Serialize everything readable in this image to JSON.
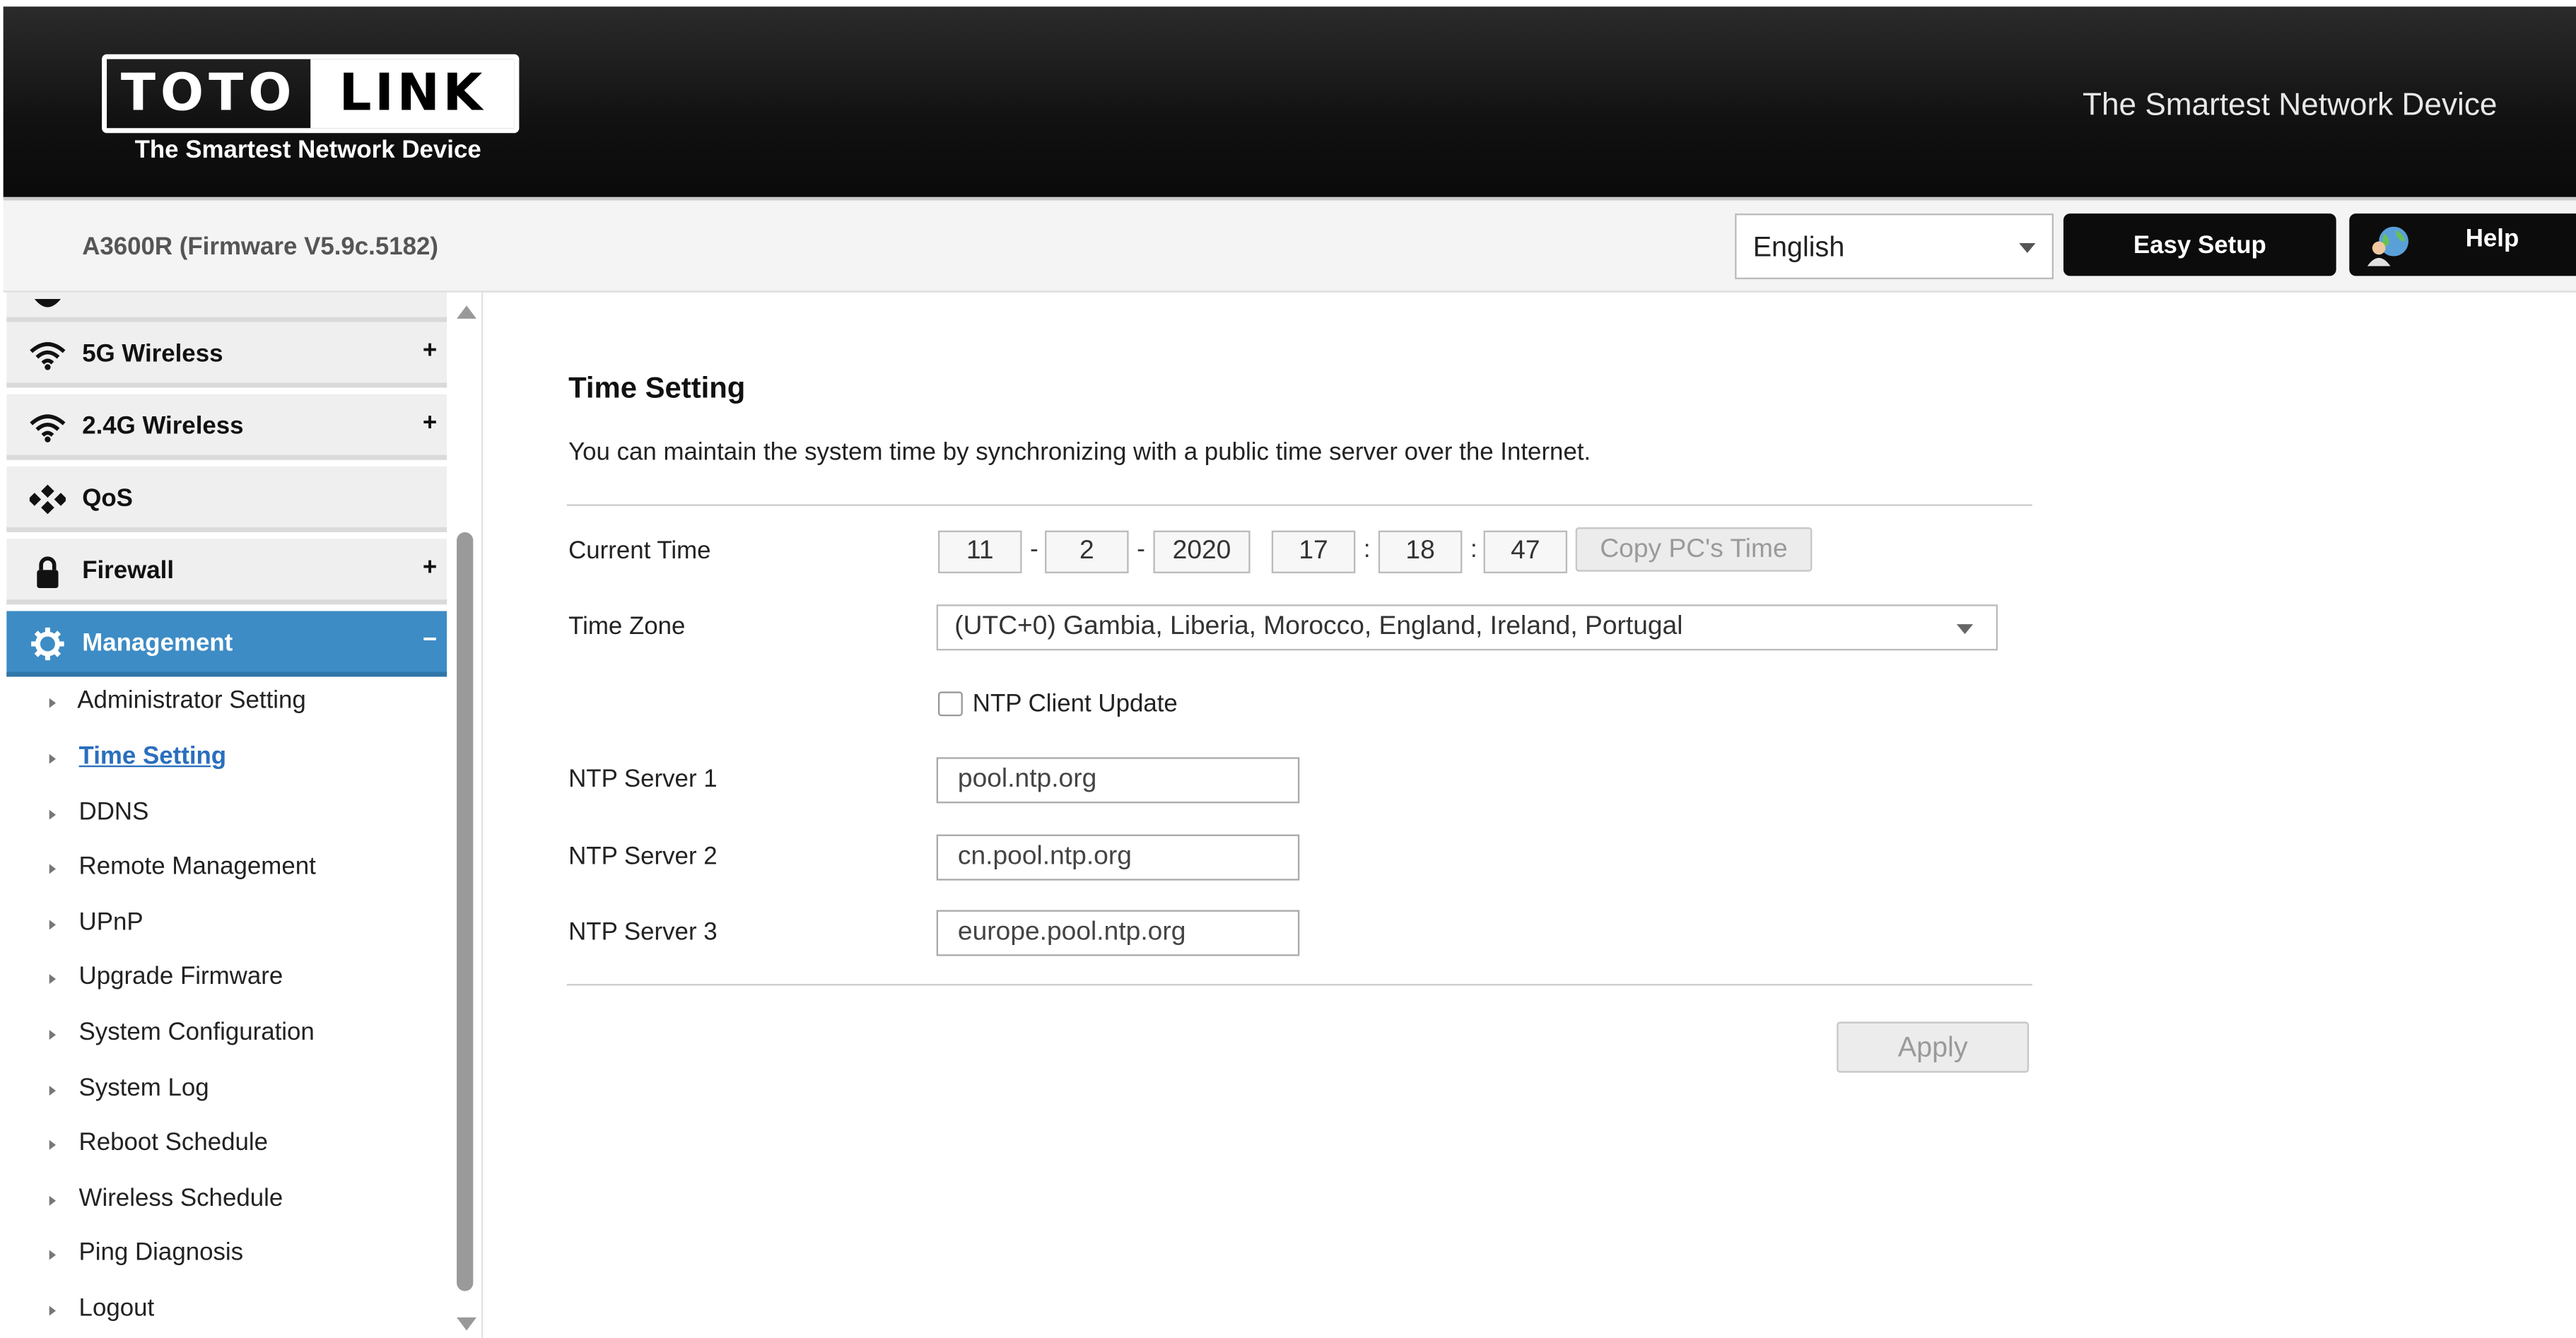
{
  "header": {
    "logo_left": "TOTO",
    "logo_right": "LINK",
    "logo_tagline": "The Smartest Network Device",
    "right_tagline": "The Smartest Network Device"
  },
  "topbar": {
    "model": "A3600R (Firmware V5.9c.5182)",
    "language": "English",
    "easy_setup": "Easy Setup",
    "help": "Help"
  },
  "sidebar": {
    "items": [
      {
        "label": "5G Wireless",
        "expand": "+",
        "icon": "wifi-icon"
      },
      {
        "label": "2.4G Wireless",
        "expand": "+",
        "icon": "wifi-icon"
      },
      {
        "label": "QoS",
        "expand": "",
        "icon": "qos-icon"
      },
      {
        "label": "Firewall",
        "expand": "+",
        "icon": "lock-icon"
      },
      {
        "label": "Management",
        "expand": "−",
        "icon": "gear-icon",
        "active": true
      }
    ],
    "submenu": [
      "Administrator Setting",
      "Time Setting",
      "DDNS",
      "Remote Management",
      "UPnP",
      "Upgrade Firmware",
      "System Configuration",
      "System Log",
      "Reboot Schedule",
      "Wireless Schedule",
      "Ping Diagnosis",
      "Logout"
    ],
    "current_submenu": "Time Setting"
  },
  "content": {
    "title": "Time Setting",
    "description": "You can maintain the system time by synchronizing with a public time server over the Internet.",
    "current_time": {
      "label": "Current Time",
      "month": "11",
      "day": "2",
      "year": "2020",
      "hour": "17",
      "minute": "18",
      "second": "47",
      "date_sep": "-",
      "time_sep": ":",
      "copy_button": "Copy PC's Time"
    },
    "time_zone": {
      "label": "Time Zone",
      "value": "(UTC+0) Gambia, Liberia, Morocco, England, Ireland, Portugal"
    },
    "ntp_client": {
      "label": "NTP Client Update",
      "checked": false
    },
    "ntp_servers": [
      {
        "label": "NTP Server 1",
        "value": "pool.ntp.org"
      },
      {
        "label": "NTP Server 2",
        "value": "cn.pool.ntp.org"
      },
      {
        "label": "NTP Server 3",
        "value": "europe.pool.ntp.org"
      }
    ],
    "apply": "Apply"
  },
  "colors": {
    "header_bg": "#111111",
    "active_menu": "#3d8cc5",
    "link": "#2a6fbd"
  }
}
